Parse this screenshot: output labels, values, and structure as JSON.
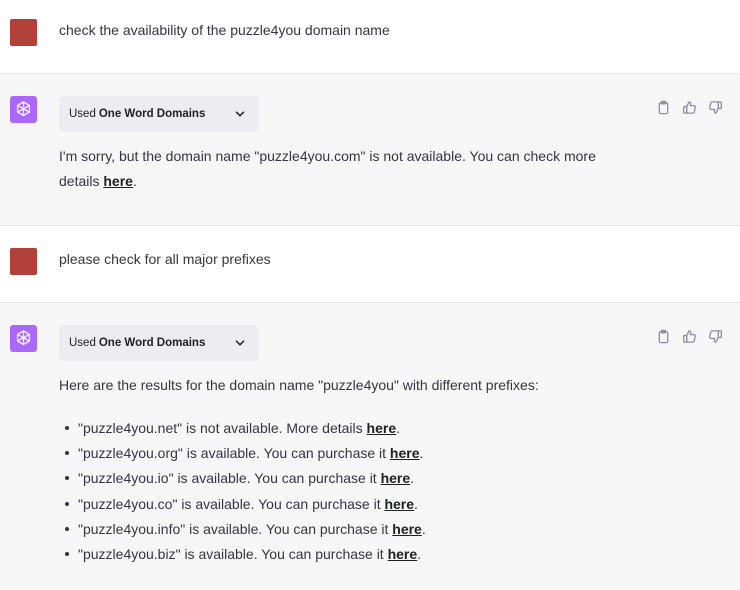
{
  "conversation": {
    "messages": [
      {
        "role": "user",
        "text": "check the availability of the puzzle4you domain name"
      },
      {
        "role": "assistant",
        "plugin": {
          "used_label": "Used",
          "name": "One Word Domains"
        },
        "text_before": "I'm sorry, but the domain name \"puzzle4you.com\" is not available. You can check more details ",
        "link": "here",
        "text_after": "."
      },
      {
        "role": "user",
        "text": "please check for all major prefixes"
      },
      {
        "role": "assistant",
        "plugin": {
          "used_label": "Used",
          "name": "One Word Domains"
        },
        "intro": "Here are the results for the domain name \"puzzle4you\" with different prefixes:",
        "results": [
          {
            "text": "\"puzzle4you.net\" is not available. More details ",
            "link": "here",
            "end": "."
          },
          {
            "text": "\"puzzle4you.org\" is available. You can purchase it ",
            "link": "here",
            "end": "."
          },
          {
            "text": "\"puzzle4you.io\" is available. You can purchase it ",
            "link": "here",
            "end": "."
          },
          {
            "text": "\"puzzle4you.co\" is available. You can purchase it ",
            "link": "here",
            "end": "."
          },
          {
            "text": "\"puzzle4you.info\" is available. You can purchase it ",
            "link": "here",
            "end": "."
          },
          {
            "text": "\"puzzle4you.biz\" is available. You can purchase it ",
            "link": "here",
            "end": "."
          }
        ]
      }
    ]
  },
  "icons": {
    "bot_avatar": "openai-logo-icon",
    "copy": "clipboard-icon",
    "like": "thumbs-up-icon",
    "dislike": "thumbs-down-icon",
    "expand": "chevron-down-icon"
  },
  "colors": {
    "user_avatar": "#b2413a",
    "bot_avatar": "#ab68ff",
    "assistant_bg": "#f7f7f8"
  }
}
